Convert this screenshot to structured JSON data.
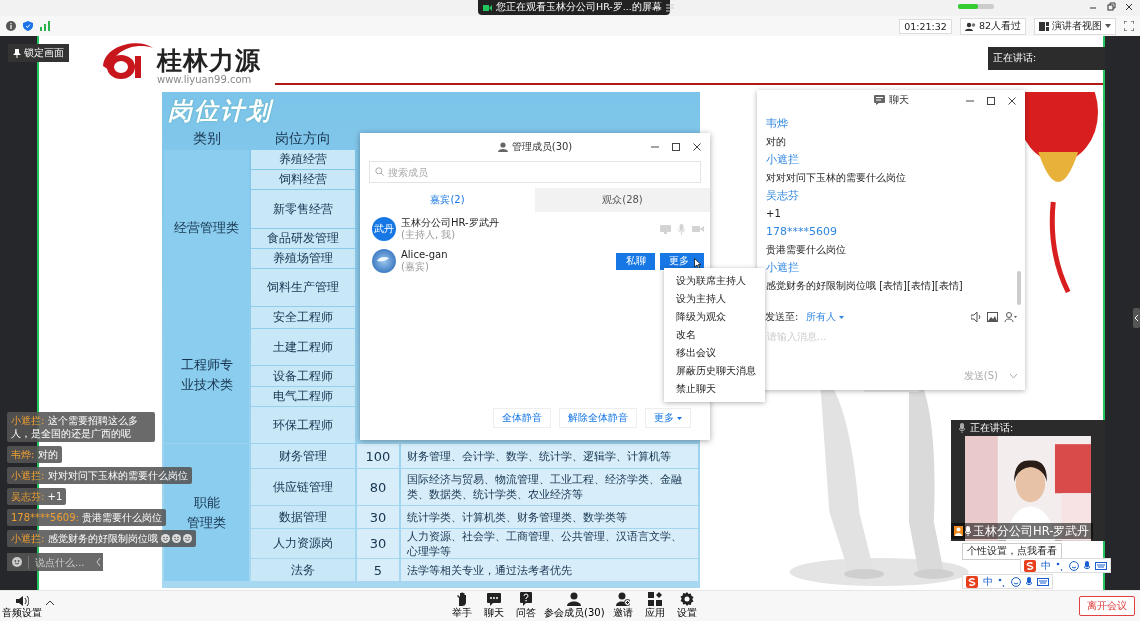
{
  "top_bar": {
    "share_notice": "您正在观看玉林分公司HR-罗...的屏幕"
  },
  "status": {
    "timer": "01:21:32",
    "viewers": "82人看过",
    "view_mode": "演讲者视图"
  },
  "lock_button": "锁定画面",
  "slide": {
    "brand": "桂林力源",
    "url": "www.liyuan99.com",
    "title": "岗位计划",
    "headers": [
      "类别",
      "岗位方向"
    ],
    "groups": [
      {
        "category": [
          "经营管理类"
        ],
        "rows": [
          {
            "position": "养殖经营"
          },
          {
            "position": "饲料经营"
          },
          {
            "position": "新零售经营"
          },
          {
            "position": "食品研发管理"
          },
          {
            "position": "养殖场管理"
          },
          {
            "position": "饲料生产管理"
          }
        ]
      },
      {
        "category": [
          "工程师专",
          "业技术类"
        ],
        "rows": [
          {
            "position": "安全工程师"
          },
          {
            "position": "土建工程师"
          },
          {
            "position": "设备工程师"
          },
          {
            "position": "电气工程师"
          },
          {
            "position": "环保工程师"
          }
        ]
      },
      {
        "category": [
          "职能",
          "管理类"
        ],
        "rows": [
          {
            "position": "财务管理",
            "count": "100",
            "description": "财务管理、会计学、数学、统计学、逻辑学、计算机等"
          },
          {
            "position": "供应链管理",
            "count": "80",
            "description": "国际经济与贸易、物流管理、工业工程、经济学类、金融类、数据类、统计学类、农业经济等"
          },
          {
            "position": "数据管理",
            "count": "30",
            "description": "统计学类、计算机类、财务管理类、数学类等"
          },
          {
            "position": "人力资源岗",
            "count": "30",
            "description": "人力资源、社会学、工商管理、公共管理、汉语言文学、心理学等"
          },
          {
            "position": "法务",
            "count": "5",
            "description": "法学等相关专业，通过法考者优先"
          }
        ]
      }
    ]
  },
  "member_dialog": {
    "title": "管理成员(30)",
    "search_placeholder": "搜索成员",
    "tabs": [
      {
        "label": "嘉宾(2)",
        "selected": true
      },
      {
        "label": "观众(28)",
        "selected": false
      }
    ],
    "members": [
      {
        "kind": "host",
        "avatar_text": "武丹",
        "name": "玉林分公司HR-罗武丹",
        "role": "(主持人, 我)"
      },
      {
        "kind": "guest",
        "name": "Alice-gan",
        "role": "(嘉宾)",
        "actions": [
          "私聊",
          "更多"
        ]
      }
    ],
    "footer_buttons": [
      "全体静音",
      "解除全体静音",
      "更多"
    ]
  },
  "context_menu": [
    "设为联席主持人",
    "设为主持人",
    "降级为观众",
    "改名",
    "移出会议",
    "屏蔽历史聊天消息",
    "禁止聊天"
  ],
  "chat": {
    "title": "聊天",
    "messages": [
      {
        "sender": "韦烨",
        "text": "对的"
      },
      {
        "sender": "小遮拦",
        "text": "对对对问下玉林的需要什么岗位"
      },
      {
        "sender": "吴志芬",
        "text": "+1"
      },
      {
        "sender": "178****5609",
        "text": "贵港需要什么岗位"
      },
      {
        "sender": "小遮拦",
        "text": "感觉财务的好限制岗位哦 [表情][表情][表情]"
      }
    ],
    "send_to_label": "发送至:",
    "recipient": "所有人",
    "input_placeholder": "请输入消息...",
    "send_button": "发送(S)"
  },
  "overlay_chat": {
    "messages": [
      {
        "sender": "小遮拦:",
        "text": "这个需要招聘这么多人，是全国的还是广西的呢"
      },
      {
        "sender": "韦烨:",
        "text": "对的"
      },
      {
        "sender": "小遮拦:",
        "text": "对对对问下玉林的需要什么岗位"
      },
      {
        "sender": "吴志芬:",
        "text": "+1"
      },
      {
        "sender": "178****5609:",
        "text": "贵港需要什么岗位"
      },
      {
        "sender": "小遮拦:",
        "text": "感觉财务的好限制岗位哦",
        "emoji": true
      }
    ],
    "input_placeholder": "说点什么..."
  },
  "speaker_box": {
    "label": "正在讲话:"
  },
  "video_tile": {
    "label": "正在讲话:",
    "name": "玉林分公司HR-罗武丹",
    "tooltip": "个性设置，点我看看"
  },
  "ime_bars": [
    "中",
    "中"
  ],
  "bottom_bar": {
    "audio": "音频设置",
    "items": [
      "举手",
      "聊天",
      "问答",
      "参会成员(30)",
      "邀请",
      "应用",
      "设置"
    ],
    "leave": "离开会议"
  }
}
